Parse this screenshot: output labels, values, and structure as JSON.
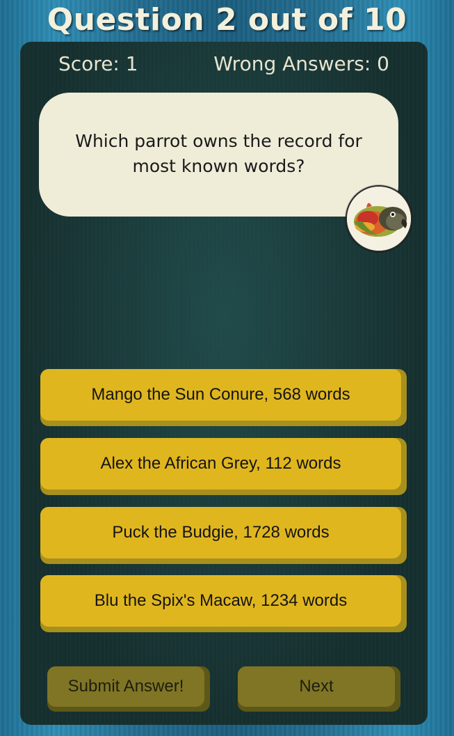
{
  "header": {
    "title": "Question 2 out of 10"
  },
  "stats": {
    "score": "Score: 1",
    "wrong_answers": "Wrong Answers: 0"
  },
  "question": {
    "text": "Which parrot owns the record for most known words?",
    "avatar_icon": "sun-conure-parrot-image"
  },
  "answers": [
    "Mango the Sun Conure, 568 words",
    "Alex the African Grey, 112 words",
    "Puck the Budgie, 1728 words",
    "Blu the Spix's Macaw, 1234 words"
  ],
  "actions": {
    "submit_label": "Submit Answer!",
    "next_label": "Next"
  },
  "colors": {
    "answer_button": "#e0b61f",
    "action_button": "#7f7524",
    "bubble": "#efecd8",
    "panel": "#16302f",
    "title_text": "#f3f0dc"
  }
}
